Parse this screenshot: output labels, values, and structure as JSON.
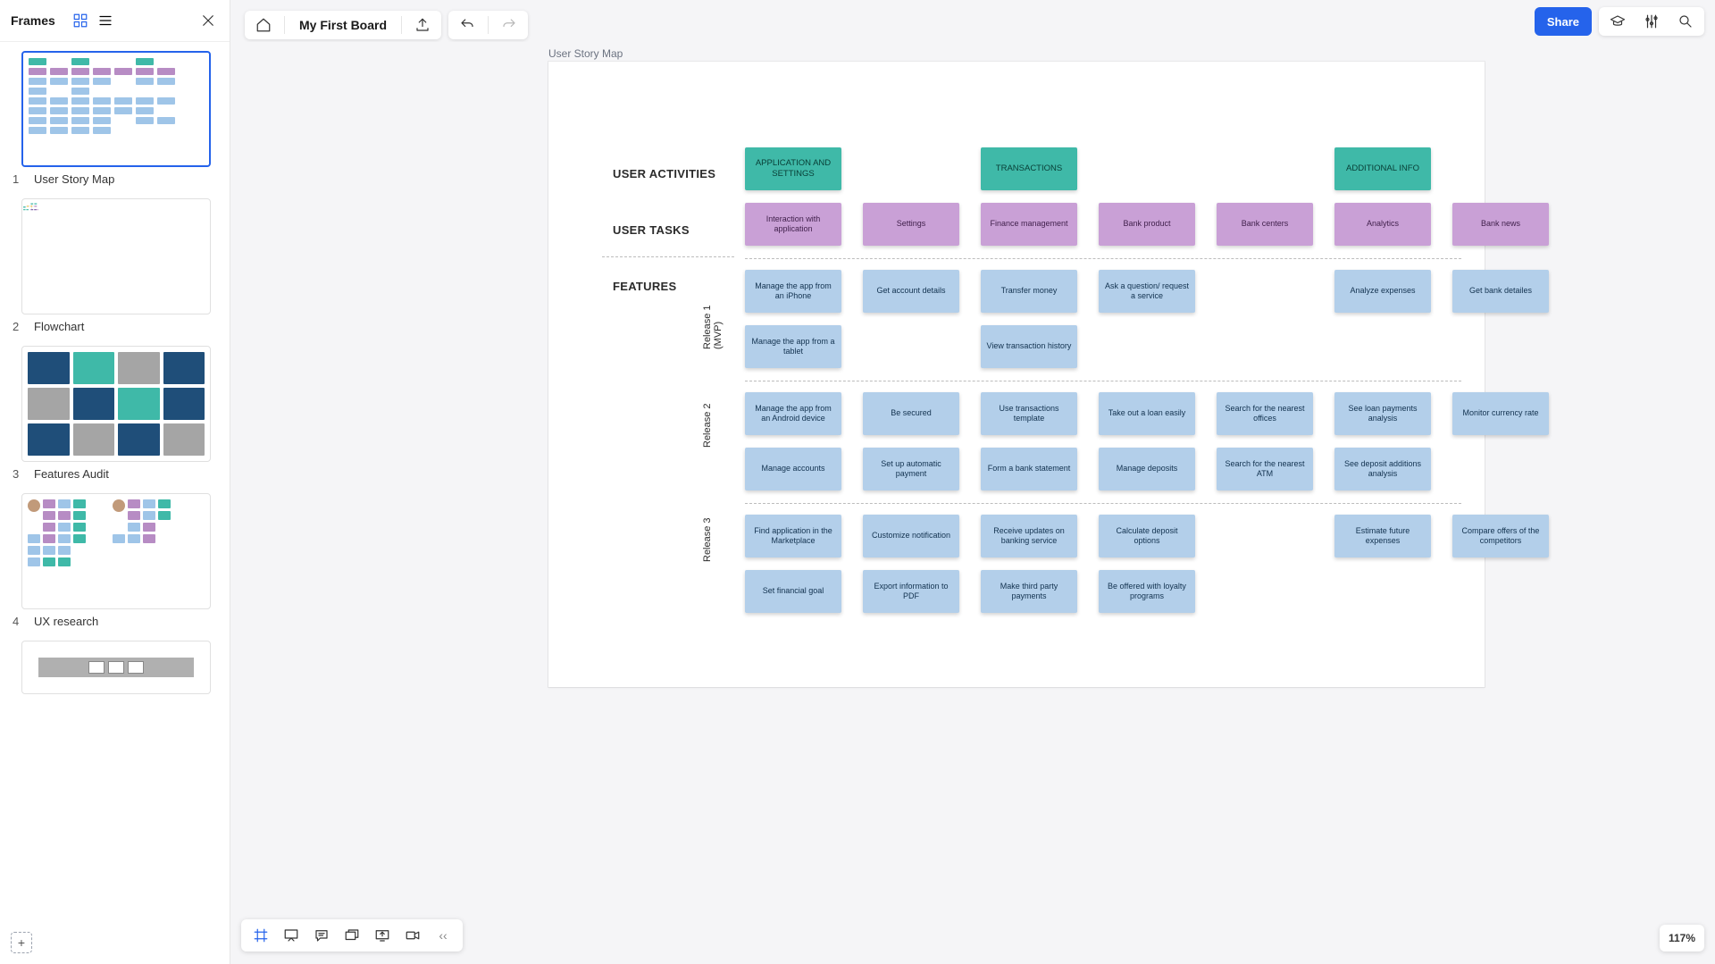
{
  "sidebar": {
    "title": "Frames",
    "frames": [
      {
        "num": "1",
        "label": "User Story Map"
      },
      {
        "num": "2",
        "label": "Flowchart"
      },
      {
        "num": "3",
        "label": "Features Audit"
      },
      {
        "num": "4",
        "label": "UX research"
      }
    ]
  },
  "header": {
    "board_title": "My First Board",
    "share": "Share"
  },
  "canvas": {
    "frame_title": "User Story Map",
    "labels": {
      "activities": "USER ACTIVITIES",
      "tasks": "USER TASKS",
      "features": "FEATURES",
      "release1": "Release 1\n(MVP)",
      "release2": "Release 2",
      "release3": "Release 3"
    },
    "activities": [
      "APPLICATION AND SETTINGS",
      "",
      "TRANSACTIONS",
      "",
      "",
      "ADDITIONAL INFO",
      ""
    ],
    "tasks": [
      "Interaction with application",
      "Settings",
      "Finance management",
      "Bank product",
      "Bank centers",
      "Analytics",
      "Bank news"
    ],
    "r1a": [
      "Manage the app from an iPhone",
      "Get account details",
      "Transfer money",
      "Ask a question/ request a service",
      "",
      "Analyze expenses",
      "Get bank detailes"
    ],
    "r1b": [
      "Manage the app from a tablet",
      "",
      "View transaction history",
      "",
      "",
      "",
      ""
    ],
    "r2a": [
      "Manage the app from an Android device",
      "Be secured",
      "Use transactions template",
      "Take out a loan easily",
      "Search for the nearest offices",
      "See loan payments analysis",
      "Monitor currency rate"
    ],
    "r2b": [
      "Manage accounts",
      "Set up automatic payment",
      "Form a bank statement",
      "Manage deposits",
      "Search for the nearest ATM",
      "See deposit additions analysis",
      ""
    ],
    "r3a": [
      "Find application in the Marketplace",
      "Customize notification",
      "Receive updates on banking service",
      "Calculate deposit options",
      "",
      "Estimate future expenses",
      "Compare offers of the competitors"
    ],
    "r3b": [
      "Set financial goal",
      "Export information to PDF",
      "Make third party payments",
      "Be offered with loyalty programs",
      "",
      "",
      ""
    ]
  },
  "zoom": "117%"
}
